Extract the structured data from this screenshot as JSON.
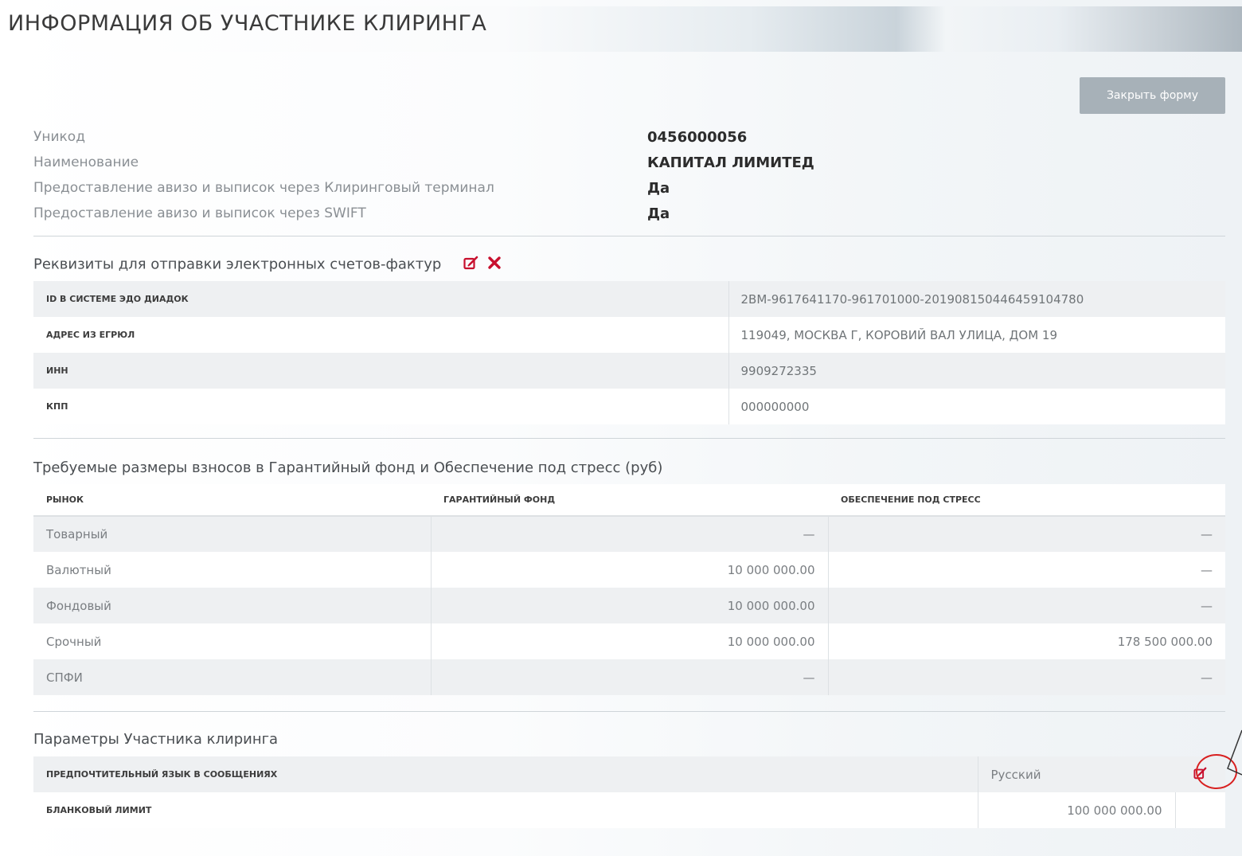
{
  "page": {
    "title": "ИНФОРМАЦИЯ ОБ УЧАСТНИКЕ КЛИРИНГА",
    "close_button": "Закрыть форму"
  },
  "info": [
    {
      "label": "Уникод",
      "value": "0456000056"
    },
    {
      "label": "Наименование",
      "value": "КАПИТАЛ ЛИМИТЕД"
    },
    {
      "label": "Предоставление авизо и выписок через Клиринговый терминал",
      "value": "Да"
    },
    {
      "label": "Предоставление авизо и выписок через SWIFT",
      "value": "Да"
    }
  ],
  "requisites": {
    "title": "Реквизиты для отправки электронных счетов-фактур",
    "rows": [
      {
        "key": "ID в системе ЭДО Диадок",
        "value": "2BM-9617641170-961701000-201908150446459104780"
      },
      {
        "key": "Адрес из ЕГРЮЛ",
        "value": "119049, МОСКВА Г, КОРОВИЙ ВАЛ УЛИЦА, ДОМ 19"
      },
      {
        "key": "ИНН",
        "value": "9909272335"
      },
      {
        "key": "КПП",
        "value": "000000000"
      }
    ]
  },
  "fund": {
    "title": "Требуемые размеры взносов в Гарантийный фонд и Обеспечение под стресс (руб)",
    "headers": [
      "Рынок",
      "Гарантийный фонд",
      "Обеспечение под стресс"
    ],
    "rows": [
      [
        "Товарный",
        "—",
        "—"
      ],
      [
        "Валютный",
        "10 000 000.00",
        "—"
      ],
      [
        "Фондовый",
        "10 000 000.00",
        "—"
      ],
      [
        "Срочный",
        "10 000 000.00",
        "178 500 000.00"
      ],
      [
        "СПФИ",
        "—",
        "—"
      ]
    ]
  },
  "params": {
    "title": "Параметры Участника клиринга",
    "rows": [
      {
        "key": "Предпочтительный язык в сообщениях",
        "value": "Русский"
      },
      {
        "key": "Бланковый лимит",
        "value": "100 000 000.00"
      }
    ]
  },
  "colors": {
    "accent_red": "#c8102e",
    "button_bg": "#a7b1b8",
    "row_alt": "#eef0f2"
  },
  "icons": {
    "edit": "edit-icon",
    "delete": "close-icon"
  }
}
